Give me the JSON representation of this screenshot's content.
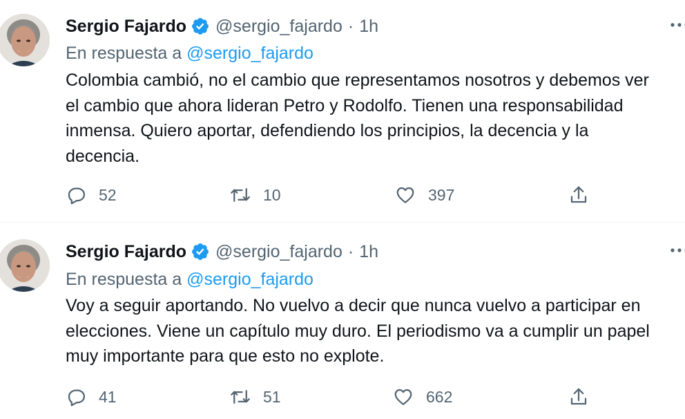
{
  "tweets": [
    {
      "author_name": "Sergio Fajardo",
      "author_handle": "@sergio_fajardo",
      "time": "1h",
      "separator": "·",
      "reply_prefix": "En respuesta a",
      "reply_mention": "@sergio_fajardo",
      "text": "Colombia cambió, no el cambio que representamos nosotros y debemos ver\nel cambio que ahora lideran Petro y Rodolfo. Tienen una responsabilidad\ninmensa. Quiero aportar, defendiendo los principios, la decencia y la\ndecencia.",
      "stats": {
        "replies": "52",
        "retweets": "10",
        "likes": "397"
      }
    },
    {
      "author_name": "Sergio Fajardo",
      "author_handle": "@sergio_fajardo",
      "time": "1h",
      "separator": "·",
      "reply_prefix": "En respuesta a",
      "reply_mention": "@sergio_fajardo",
      "text": "Voy a seguir aportando. No vuelvo a decir que nunca vuelvo a participar en\nelecciones. Viene un capítulo muy duro. El periodismo va a cumplir un papel\nmuy importante para que esto no explote.",
      "stats": {
        "replies": "41",
        "retweets": "51",
        "likes": "662"
      }
    }
  ],
  "icons": {
    "verified": "verified-badge-icon",
    "more": "more-dots-icon",
    "reply": "reply-bubble-icon",
    "retweet": "retweet-icon",
    "like": "heart-icon",
    "share": "share-upload-icon"
  },
  "colors": {
    "text": "#0f1419",
    "secondary": "#536471",
    "link": "#1d9bf0",
    "verified": "#1d9bf0",
    "separator": "#eff3f4"
  }
}
